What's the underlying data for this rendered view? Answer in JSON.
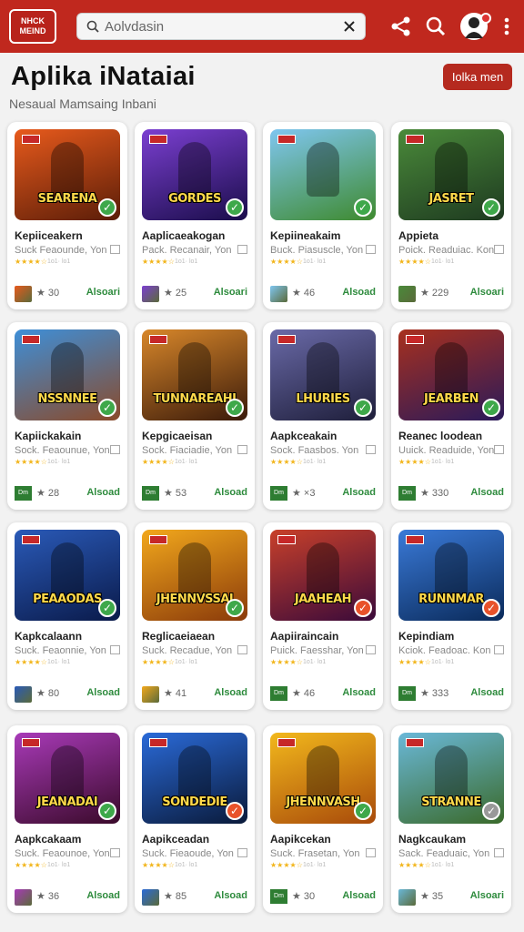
{
  "topbar": {
    "logo_lines": [
      "NHCK",
      "MEIND"
    ],
    "search_value": "Aolvdasin",
    "brand_color": "#c0281e"
  },
  "header": {
    "title": "Aplika iNataiai",
    "subtitle": "Nesaual Mamsaing Inbani",
    "button_label": "Iolka men"
  },
  "apps": [
    {
      "name": "Kepiiceakern",
      "publisher": "Suck Feaounde, Yon",
      "rating": "★ 30",
      "action": "Alsoari",
      "thumb_title": "SEARENA",
      "thumb_colors": [
        "#e85a1c",
        "#5a1d08"
      ],
      "check_color": "#3ea84a",
      "footer": "thumb"
    },
    {
      "name": "Aaplicaeakogan",
      "publisher": "Pack. Recanair, Yon",
      "rating": "★ 25",
      "action": "Alsoari",
      "thumb_title": "GORDES",
      "thumb_colors": [
        "#7b3fd1",
        "#1a0d4a"
      ],
      "check_color": "#3ea84a",
      "footer": "thumb"
    },
    {
      "name": "Kepiineakaim",
      "publisher": "Buck. Piasuscle, Yon",
      "rating": "★ 46",
      "action": "Alsoad",
      "thumb_title": "",
      "thumb_colors": [
        "#7fc6f0",
        "#3e8a2e"
      ],
      "check_color": "#3ea84a",
      "footer": "thumb"
    },
    {
      "name": "Appieta",
      "publisher": "Poick. Readuiac. Kon",
      "rating": "★ 229",
      "action": "Alsoari",
      "thumb_title": "JASRET",
      "thumb_colors": [
        "#4a8a3a",
        "#1e3a20"
      ],
      "check_color": "#3ea84a",
      "footer": "thumb"
    },
    {
      "name": "Kapiickakain",
      "publisher": "Sock. Feaounue, Yon",
      "rating": "★ 28",
      "action": "Alsoad",
      "thumb_title": "NSSNNEE",
      "thumb_colors": [
        "#3e8fd8",
        "#8a4a2a"
      ],
      "check_color": "#3ea84a",
      "footer": "label"
    },
    {
      "name": "Kepgicaeisan",
      "publisher": "Sock. Fiaciadie, Yon",
      "rating": "★ 53",
      "action": "Alsoad",
      "thumb_title": "TUNNAREAHI",
      "thumb_colors": [
        "#d8872a",
        "#3a1a0a"
      ],
      "check_color": "#3ea84a",
      "footer": "label"
    },
    {
      "name": "Aapkceakain",
      "publisher": "Sock. Faasbos. Yon",
      "rating": "★ ×3",
      "action": "Alsoad",
      "thumb_title": "LHURIES",
      "thumb_colors": [
        "#6a6aa8",
        "#1e1e3a"
      ],
      "check_color": "#3ea84a",
      "footer": "label"
    },
    {
      "name": "Reanec loodean",
      "publisher": "Uuick. Readuide, Yon",
      "rating": "★ 330",
      "action": "Alsoad",
      "thumb_title": "JEARBEN",
      "thumb_colors": [
        "#a8301e",
        "#2a1a5a"
      ],
      "check_color": "#3ea84a",
      "footer": "label"
    },
    {
      "name": "Kapkcalaann",
      "publisher": "Suck. Feaonnie, Yon",
      "rating": "★ 80",
      "action": "Alsoad",
      "thumb_title": "PEAAODAS",
      "thumb_colors": [
        "#2a5ab8",
        "#0a1a4a"
      ],
      "check_color": "#3ea84a",
      "footer": "thumb"
    },
    {
      "name": "Reglicaeiaean",
      "publisher": "Suck. Recadue, Yon",
      "rating": "★ 41",
      "action": "Alsoad",
      "thumb_title": "JHENNVSSAI",
      "thumb_colors": [
        "#f2a81c",
        "#8a3a0a"
      ],
      "check_color": "#3ea84a",
      "footer": "thumb"
    },
    {
      "name": "Aapiiraincain",
      "publisher": "Puick. Faesshar, Yon",
      "rating": "★ 46",
      "action": "Alsoad",
      "thumb_title": "JAAHEAH",
      "thumb_colors": [
        "#c8402a",
        "#3a0a3a"
      ],
      "check_color": "#e8522a",
      "footer": "label"
    },
    {
      "name": "Kepindiam",
      "publisher": "Kciok. Feadoac. Kon",
      "rating": "★ 333",
      "action": "Alsoad",
      "thumb_title": "RUNNMAR",
      "thumb_colors": [
        "#3a7ad8",
        "#0a2a5a"
      ],
      "check_color": "#e8522a",
      "footer": "label"
    },
    {
      "name": "Aapkcakaam",
      "publisher": "Suck. Feaounoe, Yon",
      "rating": "★ 36",
      "action": "Alsoad",
      "thumb_title": "JEANADAI",
      "thumb_colors": [
        "#a83ab8",
        "#3a0a2a"
      ],
      "check_color": "#3ea84a",
      "footer": "thumb"
    },
    {
      "name": "Aapikceadan",
      "publisher": "Suck. Fieaoude, Yon",
      "rating": "★ 85",
      "action": "Alsoad",
      "thumb_title": "SONDEDIE",
      "thumb_colors": [
        "#2a6ad8",
        "#0a1a3a"
      ],
      "check_color": "#e8522a",
      "footer": "thumb"
    },
    {
      "name": "Aapikcekan",
      "publisher": "Suck. Frasetan, Yon",
      "rating": "★ 30",
      "action": "Alsoad",
      "thumb_title": "JHENNVASH",
      "thumb_colors": [
        "#f2b81c",
        "#a84a0a"
      ],
      "check_color": "#3ea84a",
      "footer": "label"
    },
    {
      "name": "Nagkcaukam",
      "publisher": "Sack. Feaduaic, Yon",
      "rating": "★ 35",
      "action": "Alsoari",
      "thumb_title": "STRANNE",
      "thumb_colors": [
        "#6ab8d8",
        "#3a6a2a"
      ],
      "check_color": "#999999",
      "footer": "thumb"
    }
  ],
  "card_meta": {
    "stars": "★★★★☆",
    "stars_subtext": "1o1· lo1",
    "tiny_label": "Dm",
    "tiny_thumb_color": "#5a6a3a",
    "check_glyph": "✓"
  }
}
